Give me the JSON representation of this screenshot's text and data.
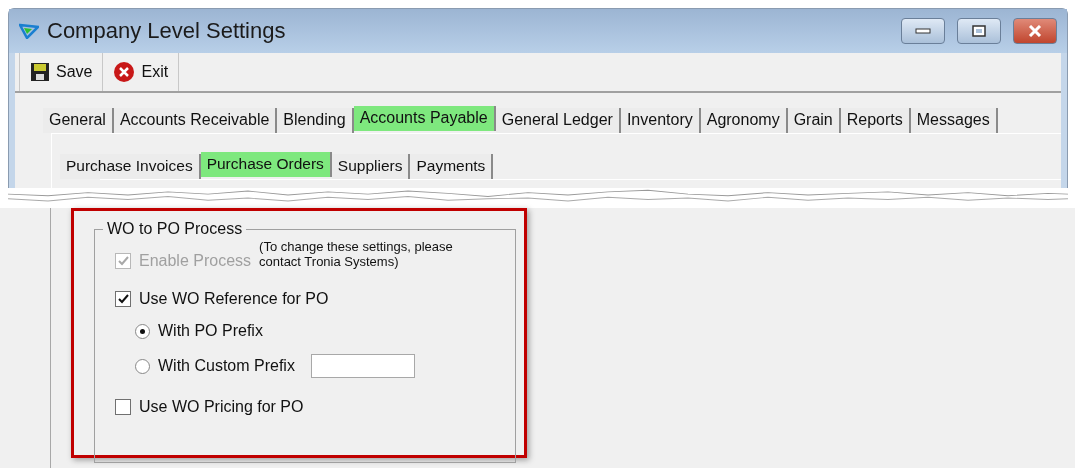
{
  "window": {
    "title": "Company Level Settings"
  },
  "toolbar": [
    {
      "kind": "save",
      "label": "Save"
    },
    {
      "kind": "exit",
      "label": "Exit"
    }
  ],
  "tabs": [
    {
      "label": "General",
      "selected": false
    },
    {
      "label": "Accounts Receivable",
      "selected": false
    },
    {
      "label": "Blending",
      "selected": false
    },
    {
      "label": "Accounts Payable",
      "selected": true
    },
    {
      "label": "General Ledger",
      "selected": false
    },
    {
      "label": "Inventory",
      "selected": false
    },
    {
      "label": "Agronomy",
      "selected": false
    },
    {
      "label": "Grain",
      "selected": false
    },
    {
      "label": "Reports",
      "selected": false
    },
    {
      "label": "Messages",
      "selected": false
    }
  ],
  "subtabs": [
    {
      "label": "Purchase Invoices",
      "selected": false
    },
    {
      "label": "Purchase Orders",
      "selected": true
    },
    {
      "label": "Suppliers",
      "selected": false
    },
    {
      "label": "Payments",
      "selected": false
    }
  ],
  "group": {
    "title": "WO to PO Process",
    "note": "(To change these settings, please contact Tronia Systems)",
    "options": [
      {
        "kind": "checkbox",
        "label": "Enable Process",
        "checked": true,
        "disabled": true
      },
      {
        "kind": "checkbox",
        "label": "Use WO Reference for PO",
        "checked": true,
        "disabled": false,
        "children": [
          {
            "kind": "radio",
            "label": "With PO Prefix",
            "selected": true
          },
          {
            "kind": "radio_field",
            "label": "With Custom Prefix",
            "selected": false
          }
        ]
      },
      {
        "kind": "checkbox",
        "label": "Use WO Pricing for PO",
        "checked": false,
        "disabled": false
      }
    ]
  }
}
